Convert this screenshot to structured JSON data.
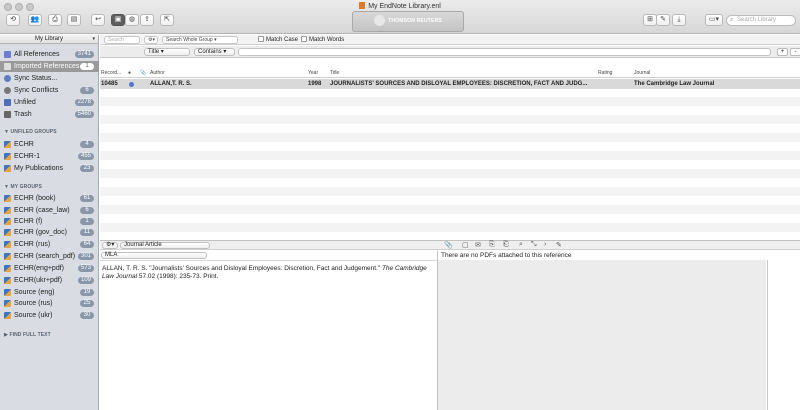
{
  "window": {
    "title": "My EndNote Library.enl"
  },
  "toolbar": {
    "vendor_logo": "THOMSON REUTERS",
    "search_library_placeholder": "Search Library"
  },
  "sidebar": {
    "header": "My Library",
    "items": [
      {
        "label": "All References",
        "count": "3741"
      },
      {
        "label": "Imported References",
        "count": "1"
      },
      {
        "label": "Sync Status..."
      },
      {
        "label": "Sync Conflicts",
        "count": "6"
      },
      {
        "label": "Unfiled",
        "count": "2278"
      },
      {
        "label": "Trash",
        "count": "5460"
      }
    ],
    "unfiled_groups_header": "UNFILED GROUPS",
    "unfiled_groups": [
      {
        "label": "ECHR",
        "count": "4"
      },
      {
        "label": "ECHR-1",
        "count": "455"
      },
      {
        "label": "My Publications",
        "count": "23"
      }
    ],
    "my_groups_header": "MY GROUPS",
    "my_groups": [
      {
        "label": "ECHR (book)",
        "count": "61"
      },
      {
        "label": "ECHR (case_law)",
        "count": "6"
      },
      {
        "label": "ECHR (f)",
        "count": "1"
      },
      {
        "label": "ECHR (gov_doc)",
        "count": "11"
      },
      {
        "label": "ECHR (rus)",
        "count": "64"
      },
      {
        "label": "ECHR (search_pdf)",
        "count": "301"
      },
      {
        "label": "ECHR(eng+pdf)",
        "count": "573"
      },
      {
        "label": "ECHR(ukr+pdf)",
        "count": "109"
      },
      {
        "label": "Source (eng)",
        "count": "19"
      },
      {
        "label": "Source (rus)",
        "count": "25"
      },
      {
        "label": "Source (ukr)",
        "count": "30"
      }
    ],
    "find_full_text_header": "FIND FULL TEXT"
  },
  "search": {
    "placeholder": "Search",
    "scope": "Search Whole Group",
    "match_case": "Match Case",
    "match_words": "Match Words",
    "field": "Title",
    "operator": "Contains",
    "add": "+",
    "remove": "-"
  },
  "table": {
    "headers": {
      "record": "Record...",
      "author": "Author",
      "year": "Year",
      "title": "Title",
      "rating": "Rating",
      "journal": "Journal"
    },
    "rows": [
      {
        "record": "10485",
        "author": "ALLAN,T. R. S.",
        "year": "1998",
        "title": "JOURNALISTS' SOURCES AND DISLOYAL EMPLOYEES: DISCRETION, FACT AND JUDG...",
        "journal": "The Cambridge Law Journal"
      }
    ]
  },
  "reference_panel": {
    "ref_type": "Journal Article",
    "style": "MLA",
    "citation_pre": "ALLAN, T. R. S. \"Journalists' Sources and Disloyal Employees: Discretion, Fact and Judgement.\" ",
    "citation_journal": "The Cambridge Law Journal",
    "citation_post": " 57.02 (1998): 235-73. Print.",
    "pdf_message": "There are no PDFs attached to this reference"
  },
  "colors": {
    "count_badge": "#8a97ab",
    "selected_row": "#d9d9d9",
    "read_dot": "#5571d0"
  }
}
